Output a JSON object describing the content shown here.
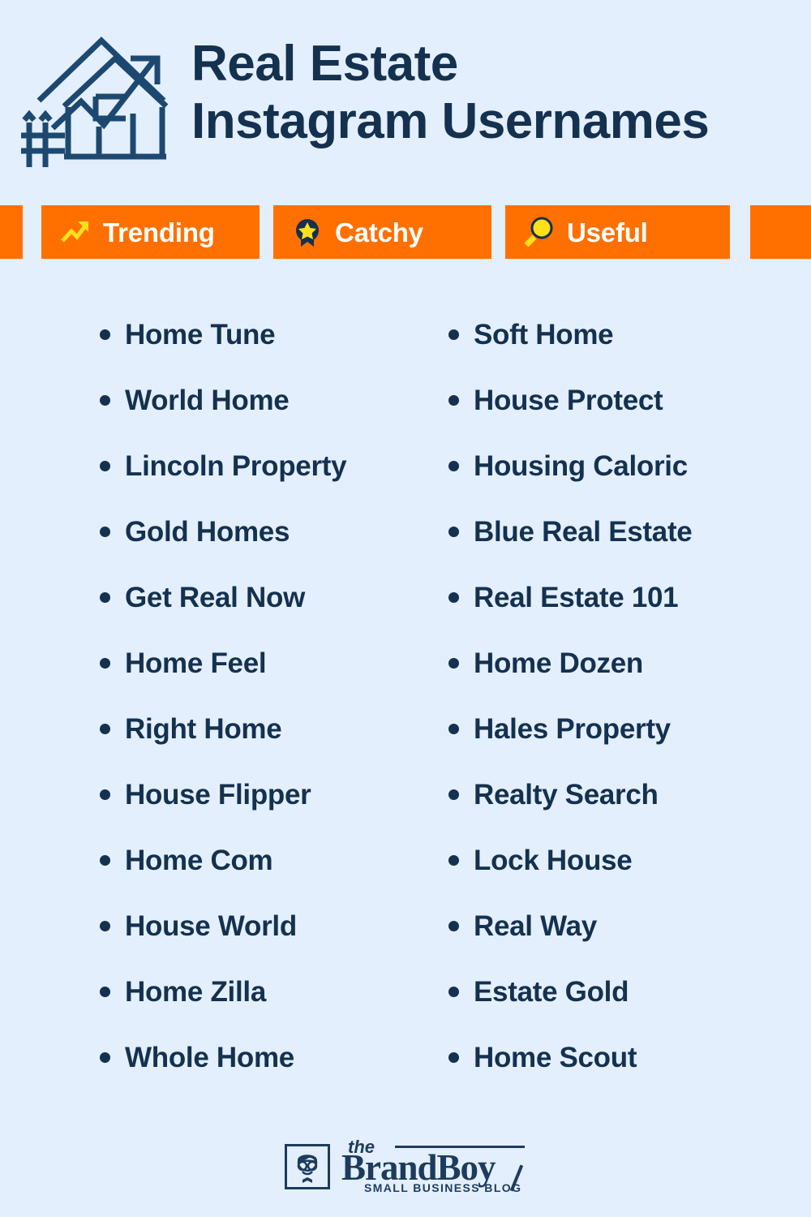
{
  "colors": {
    "background": "#e3effd",
    "navy": "#14314f",
    "orange": "#ff7000",
    "yellow": "#ffe01b",
    "white": "#ffffff",
    "footer_navy": "#1d3c5c"
  },
  "header": {
    "icon_name": "house-growth-arrow-icon",
    "title_line1": "Real Estate",
    "title_line2": "Instagram Usernames"
  },
  "badges": [
    {
      "label": "Trending",
      "icon": "trending-arrow-icon"
    },
    {
      "label": "Catchy",
      "icon": "award-ribbon-star-icon"
    },
    {
      "label": "Useful",
      "icon": "magnifying-glass-icon"
    }
  ],
  "list": {
    "left_column": [
      "Home Tune",
      "World Home",
      "Lincoln Property",
      "Gold Homes",
      "Get Real Now",
      "Home Feel",
      "Right Home",
      "House Flipper",
      "Home Com",
      "House World",
      "Home Zilla",
      "Whole Home"
    ],
    "right_column": [
      "Soft Home",
      "House Protect",
      "Housing Caloric",
      "Blue Real Estate",
      "Real Estate 101",
      "Home Dozen",
      "Hales Property",
      "Realty Search",
      "Lock House",
      "Real Way",
      "Estate Gold",
      "Home Scout"
    ]
  },
  "footer": {
    "avatar_icon": "boy-with-glasses-avatar-icon",
    "the": "the",
    "brand": "BrandBoy",
    "tagline": "SMALL BUSINESS BLOG"
  }
}
